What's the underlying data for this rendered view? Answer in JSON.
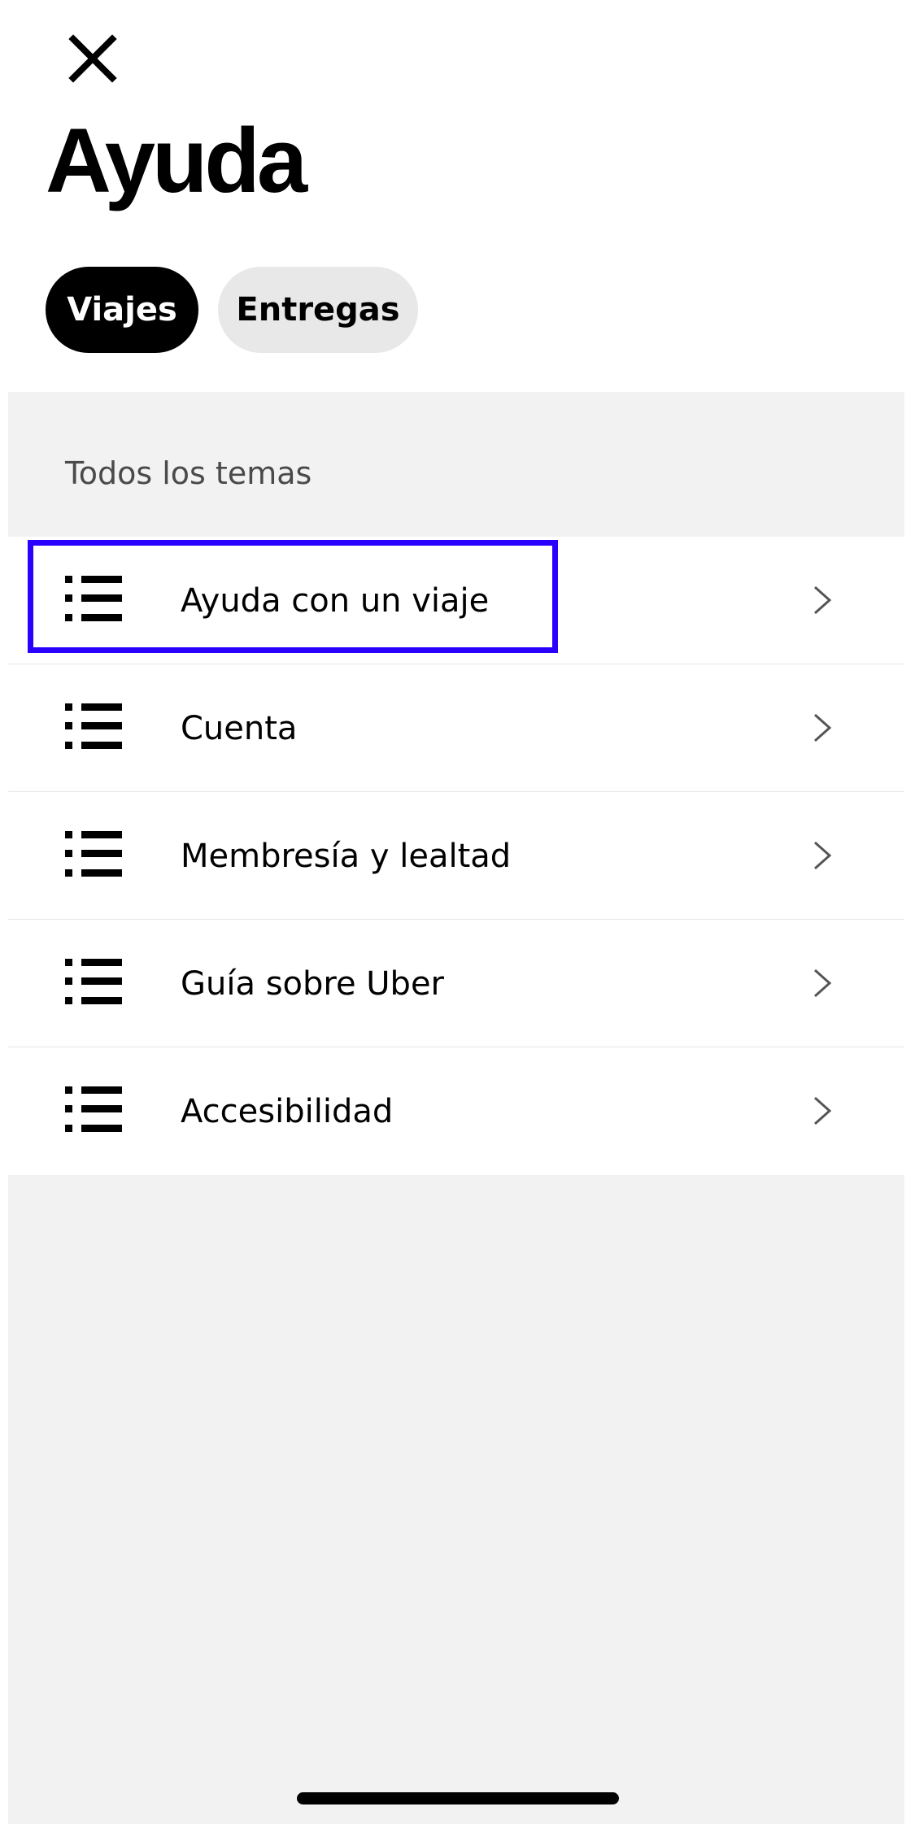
{
  "header": {
    "close_icon": "close-icon",
    "title": "Ayuda"
  },
  "tabs": [
    {
      "label": "Viajes",
      "selected": true
    },
    {
      "label": "Entregas",
      "selected": false
    }
  ],
  "section": {
    "label": "Todos los temas"
  },
  "topics": [
    {
      "label": "Ayuda con un viaje",
      "icon": "list-icon",
      "highlighted": true
    },
    {
      "label": "Cuenta",
      "icon": "list-icon"
    },
    {
      "label": "Membresía y lealtad",
      "icon": "list-icon"
    },
    {
      "label": "Guía sobre Uber",
      "icon": "list-icon"
    },
    {
      "label": "Accesibilidad",
      "icon": "list-icon"
    }
  ],
  "colors": {
    "highlight": "#2a00ff",
    "active_tab": "#000000",
    "inactive_tab": "#e8e8e8",
    "background": "#f2f2f2"
  }
}
